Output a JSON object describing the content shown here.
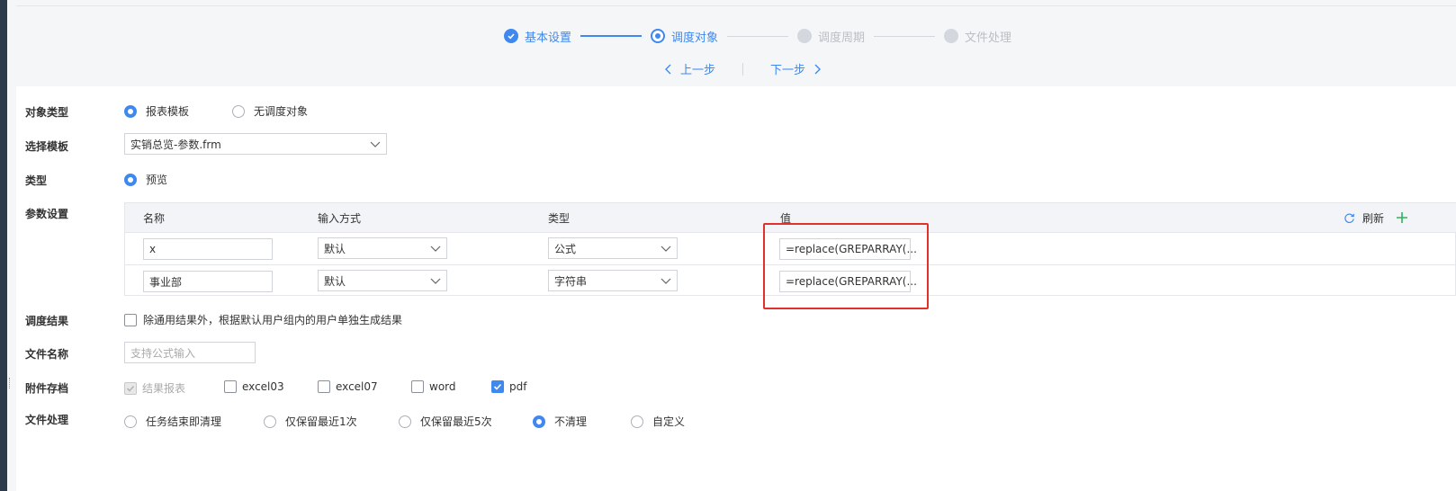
{
  "steps": [
    {
      "label": "基本设置",
      "state": "done"
    },
    {
      "label": "调度对象",
      "state": "active"
    },
    {
      "label": "调度周期",
      "state": "todo"
    },
    {
      "label": "文件处理",
      "state": "todo"
    }
  ],
  "nav": {
    "prev": "上一步",
    "next": "下一步",
    "prev_icon": "chevron-left-icon",
    "next_icon": "chevron-right-icon"
  },
  "form": {
    "object_type": {
      "label": "对象类型",
      "options": [
        "报表模板",
        "无调度对象"
      ],
      "selected": "报表模板"
    },
    "template": {
      "label": "选择模板",
      "value": "实销总览-参数.frm"
    },
    "type": {
      "label": "类型",
      "options": [
        "预览"
      ],
      "selected": "预览"
    },
    "params": {
      "label": "参数设置",
      "columns": [
        "名称",
        "输入方式",
        "类型",
        "值"
      ],
      "refresh_label": "刷新",
      "rows": [
        {
          "name": "x",
          "input_method": "默认",
          "type": "公式",
          "value": "=replace(GREPARRAY(..."
        },
        {
          "name": "事业部",
          "input_method": "默认",
          "type": "字符串",
          "value": "=replace(GREPARRAY(..."
        }
      ]
    },
    "result": {
      "label": "调度结果",
      "checkbox_label": "除通用结果外，根据默认用户组内的用户单独生成结果",
      "checked": false
    },
    "filename": {
      "label": "文件名称",
      "placeholder": "支持公式输入"
    },
    "attachments": {
      "label": "附件存档",
      "options": [
        {
          "label": "结果报表",
          "checked": true,
          "disabled": true
        },
        {
          "label": "excel03",
          "checked": false
        },
        {
          "label": "excel07",
          "checked": false
        },
        {
          "label": "word",
          "checked": false
        },
        {
          "label": "pdf",
          "checked": true
        }
      ]
    },
    "file_handling": {
      "label": "文件处理",
      "options": [
        "任务结束即清理",
        "仅保留最近1次",
        "仅保留最近5次",
        "不清理",
        "自定义"
      ],
      "selected": "不清理"
    }
  },
  "colors": {
    "accent": "#3e88f0",
    "highlight_box": "#e0312b"
  }
}
